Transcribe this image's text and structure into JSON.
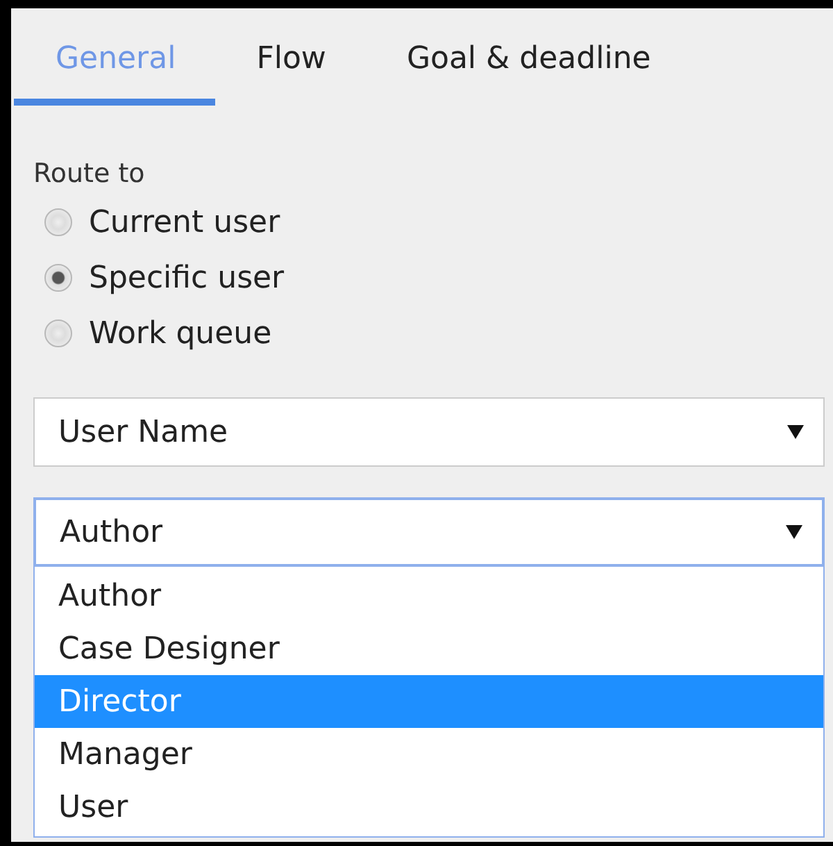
{
  "tabs": [
    {
      "label": "General",
      "selected": true
    },
    {
      "label": "Flow",
      "selected": false
    },
    {
      "label": "Goal & deadline",
      "selected": false
    }
  ],
  "route_to": {
    "label": "Route to",
    "options": [
      {
        "label": "Current user",
        "selected": false
      },
      {
        "label": "Specific user",
        "selected": true
      },
      {
        "label": "Work queue",
        "selected": false
      }
    ]
  },
  "user_field": {
    "value": "User Name"
  },
  "role_field": {
    "value": "Author",
    "expanded": true,
    "options": [
      {
        "label": "Author",
        "highlighted": false
      },
      {
        "label": "Case Designer",
        "highlighted": false
      },
      {
        "label": "Director",
        "highlighted": true
      },
      {
        "label": "Manager",
        "highlighted": false
      },
      {
        "label": "User",
        "highlighted": false
      }
    ]
  }
}
